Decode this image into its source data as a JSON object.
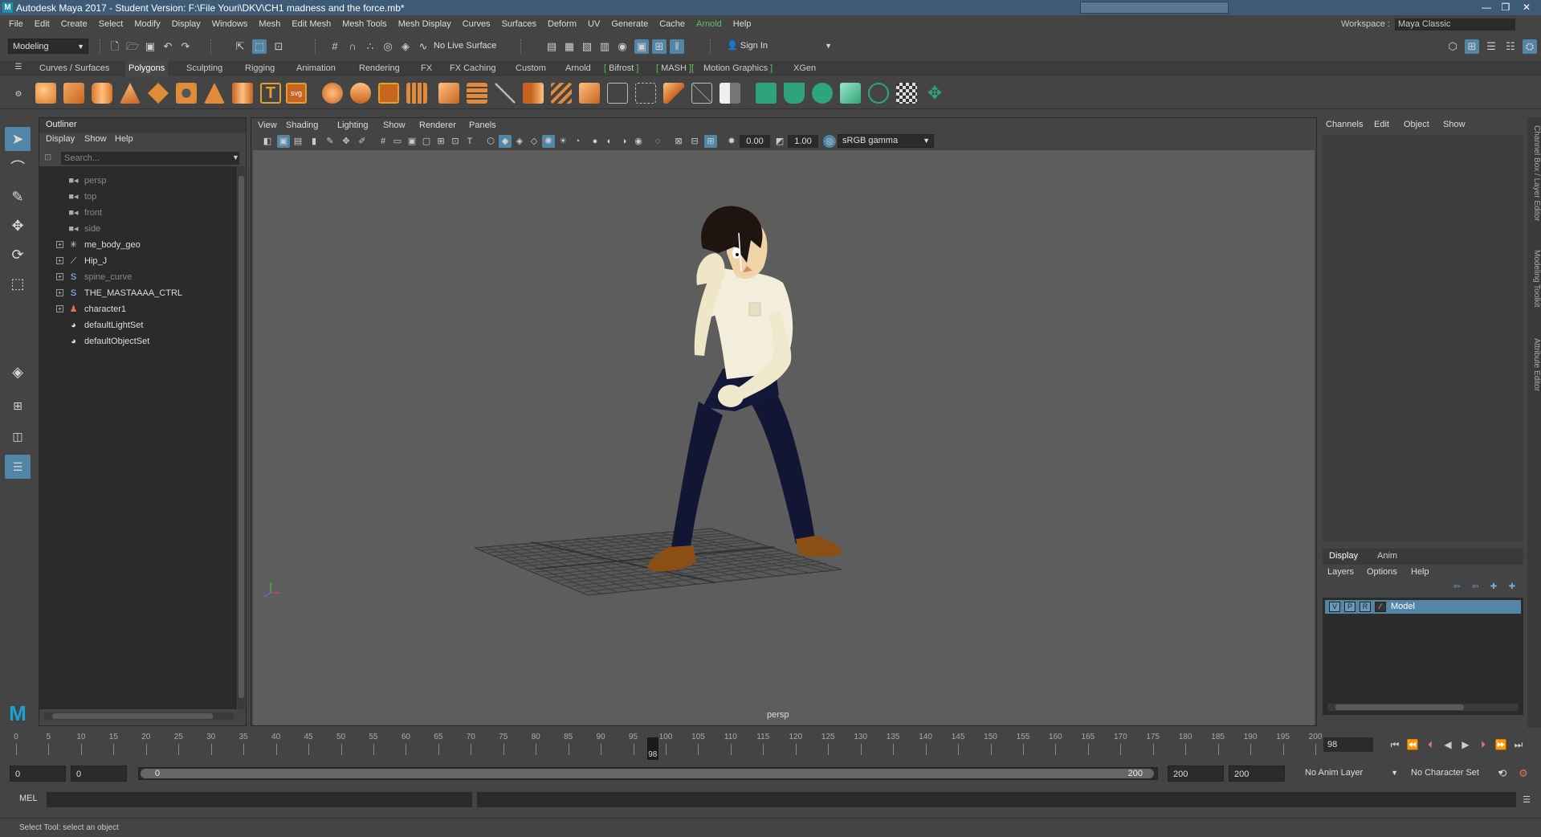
{
  "title_bar": {
    "title": "Autodesk Maya 2017 - Student Version: F:\\File Youri\\DKV\\CH1 madness and the force.mb*",
    "logo": "M",
    "window_buttons": [
      "—",
      "❒",
      "✕"
    ]
  },
  "menubar": {
    "items": [
      "File",
      "Edit",
      "Create",
      "Select",
      "Modify",
      "Display",
      "Windows",
      "Mesh",
      "Edit Mesh",
      "Mesh Tools",
      "Mesh Display",
      "Curves",
      "Surfaces",
      "Deform",
      "UV",
      "Generate",
      "Cache",
      "Arnold",
      "Help"
    ],
    "workspace_label": "Workspace :",
    "workspace_value": "Maya Classic"
  },
  "statusline": {
    "menuset": "Modeling",
    "live_surface": "No Live Surface",
    "sign_in": "Sign In"
  },
  "shelf_tabs": [
    "Curves / Surfaces",
    "Polygons",
    "Sculpting",
    "Rigging",
    "Animation",
    "Rendering",
    "FX",
    "FX Caching",
    "Custom",
    "Arnold",
    "Bifrost",
    "MASH",
    "Motion Graphics",
    "XGen"
  ],
  "shelf_active": "Polygons",
  "outliner": {
    "title": "Outliner",
    "menu": [
      "Display",
      "Show",
      "Help"
    ],
    "search_placeholder": "Search...",
    "items": [
      {
        "label": "persp",
        "icon": "camera-icon",
        "dim": true,
        "expand": false
      },
      {
        "label": "top",
        "icon": "camera-icon",
        "dim": true,
        "expand": false
      },
      {
        "label": "front",
        "icon": "camera-icon",
        "dim": true,
        "expand": false
      },
      {
        "label": "side",
        "icon": "camera-icon",
        "dim": true,
        "expand": false
      },
      {
        "label": "me_body_geo",
        "icon": "geo-icon",
        "dim": false,
        "expand": true
      },
      {
        "label": "Hip_J",
        "icon": "joint-icon",
        "dim": false,
        "expand": true
      },
      {
        "label": "spine_curve",
        "icon": "curve-icon",
        "dim": true,
        "expand": true
      },
      {
        "label": "THE_MASTAAAA_CTRL",
        "icon": "curve-icon",
        "dim": false,
        "expand": true
      },
      {
        "label": "character1",
        "icon": "character-icon",
        "dim": false,
        "expand": true
      },
      {
        "label": "defaultLightSet",
        "icon": "set-icon",
        "dim": false,
        "expand": false
      },
      {
        "label": "defaultObjectSet",
        "icon": "set-icon",
        "dim": false,
        "expand": false
      }
    ]
  },
  "viewport": {
    "menu": [
      "View",
      "Shading",
      "Lighting",
      "Show",
      "Renderer",
      "Panels"
    ],
    "exposure": "0.00",
    "gamma": "1.00",
    "color_space": "sRGB gamma",
    "camera_label": "persp"
  },
  "channel_box": {
    "menu": [
      "Channels",
      "Edit",
      "Object",
      "Show"
    ]
  },
  "layer_editor": {
    "tabs": [
      "Display",
      "Anim"
    ],
    "menu": [
      "Layers",
      "Options",
      "Help"
    ],
    "layers": [
      {
        "v": "V",
        "p": "P",
        "r": "R",
        "name": "Model"
      }
    ]
  },
  "side_tabs": [
    "Channel Box / Layer Editor",
    "Modeling Toolkit",
    "Attribute Editor"
  ],
  "timeline": {
    "ticks": [
      "0",
      "5",
      "10",
      "15",
      "20",
      "25",
      "30",
      "35",
      "40",
      "45",
      "50",
      "55",
      "60",
      "65",
      "70",
      "75",
      "80",
      "85",
      "90",
      "95",
      "100",
      "105",
      "110",
      "115",
      "120",
      "125",
      "130",
      "135",
      "140",
      "145",
      "150",
      "155",
      "160",
      "165",
      "170",
      "175",
      "180",
      "185",
      "190",
      "195",
      "200"
    ],
    "current_marker": "98",
    "current_frame": "98",
    "current_fraction": 0.49
  },
  "range": {
    "start": "0",
    "playback_start": "0",
    "bar_start_label": "0",
    "bar_end_label": "200",
    "playback_end": "200",
    "end": "200",
    "anim_layer": "No Anim Layer",
    "character_set": "No Character Set"
  },
  "command_line": {
    "label": "MEL"
  },
  "help_line": "Select Tool: select an object",
  "colors": {
    "accent": "#5285a6",
    "title_bar": "#3d5a76",
    "arnold_green": "#5ec25e",
    "shirt": "#f3eedc",
    "pants": "#121533",
    "shoes": "#8a4f15",
    "hair": "#1e1410"
  }
}
